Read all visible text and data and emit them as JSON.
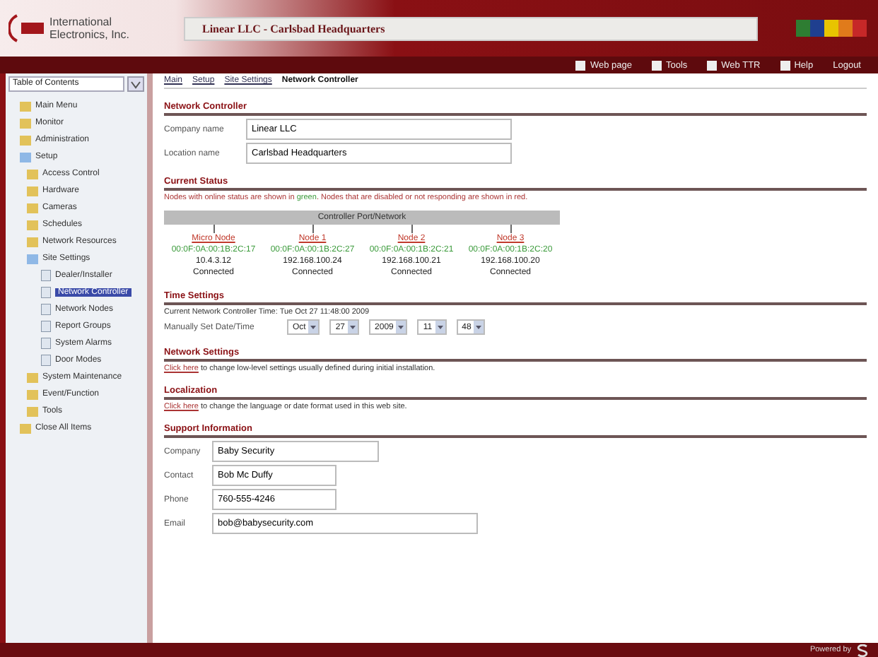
{
  "brand": {
    "name_line1": "International",
    "name_line2": "Electronics, Inc."
  },
  "window": {
    "title": "Linear LLC - Carlsbad Headquarters"
  },
  "nav": [
    {
      "label": "Web page"
    },
    {
      "label": "Tools"
    },
    {
      "label": "Web TTR"
    },
    {
      "label": "Help"
    },
    {
      "label": "Logout"
    }
  ],
  "sidebar": {
    "select": "Table of Contents",
    "items": [
      {
        "label": "Main Menu",
        "expanded": false,
        "selected": false
      },
      {
        "label": "Monitor",
        "expanded": false,
        "selected": false
      },
      {
        "label": "Administration",
        "expanded": false,
        "selected": false
      },
      {
        "label": "Setup",
        "expanded": true,
        "selected": false,
        "children": [
          {
            "label": "Access Control",
            "expanded": false,
            "selected": false
          },
          {
            "label": "Hardware",
            "expanded": false,
            "selected": false
          },
          {
            "label": "Cameras",
            "expanded": false,
            "selected": false
          },
          {
            "label": "Schedules",
            "expanded": false,
            "selected": false
          },
          {
            "label": "Network Resources",
            "expanded": false,
            "selected": false
          },
          {
            "label": "Site Settings",
            "expanded": true,
            "selected": false,
            "children": [
              {
                "label": "Dealer/Installer",
                "selected": false
              },
              {
                "label": "Network Controller",
                "selected": true
              },
              {
                "label": "Network Nodes",
                "selected": false
              },
              {
                "label": "Report Groups",
                "selected": false
              },
              {
                "label": "System Alarms",
                "selected": false
              },
              {
                "label": "Door Modes",
                "selected": false
              }
            ]
          },
          {
            "label": "System Maintenance",
            "expanded": false,
            "selected": false
          },
          {
            "label": "Event/Function",
            "expanded": false,
            "selected": false
          },
          {
            "label": "Tools",
            "expanded": false,
            "selected": false
          }
        ]
      },
      {
        "label": "Close All Items",
        "expanded": false,
        "selected": false
      }
    ]
  },
  "breadcrumb": [
    {
      "label": "Main",
      "current": false
    },
    {
      "label": "Setup",
      "current": false
    },
    {
      "label": "Site Settings",
      "current": false
    },
    {
      "label": "Network Controller",
      "current": true
    }
  ],
  "network_controller": {
    "title": "Network Controller",
    "fields": [
      {
        "label": "Company name",
        "value": "Linear LLC"
      },
      {
        "label": "Location name",
        "value": "Carlsbad Headquarters"
      }
    ]
  },
  "current_status": {
    "title": "Current Status",
    "note": "Nodes with online status are shown in **green**. Nodes that are disabled or not responding are shown in red.",
    "bus": "Controller Port/Network",
    "nodes": [
      {
        "name": "Micro Node",
        "mac": "00:0F:0A:00:1B:2C:17",
        "ip": "10.4.3.12",
        "status": "Connected",
        "color": "#3a9a3a"
      },
      {
        "name": "Node 1",
        "mac": "00:0F:0A:00:1B:2C:27",
        "ip": "192.168.100.24",
        "status": "Connected",
        "color": "#3a9a3a"
      },
      {
        "name": "Node 2",
        "mac": "00:0F:0A:00:1B:2C:21",
        "ip": "192.168.100.21",
        "status": "Connected",
        "color": "#3a9a3a"
      },
      {
        "name": "Node 3",
        "mac": "00:0F:0A:00:1B:2C:20",
        "ip": "192.168.100.20",
        "status": "Connected",
        "color": "#3a9a3a"
      }
    ]
  },
  "time_settings": {
    "title": "Time Settings",
    "current": "Current Network Controller Time: Tue Oct 27 11:48:00 2009",
    "manual_label": "Manually Set Date/Time",
    "selects": [
      "Oct",
      "27",
      "2009",
      "11",
      "48"
    ]
  },
  "network_settings": {
    "title": "Network Settings",
    "link": "Click here",
    "text": " to change low-level settings usually defined during initial installation."
  },
  "localization": {
    "title": "Localization",
    "link": "Click here",
    "text": " to change the language or date format used in this web site."
  },
  "support": {
    "title": "Support Information",
    "fields": [
      {
        "label": "Company",
        "value": "Baby Security"
      },
      {
        "label": "Contact",
        "value": "Bob Mc Duffy"
      },
      {
        "label": "Phone",
        "value": "760-555-4246"
      },
      {
        "label": "Email",
        "value": "bob@babysecurity.com"
      }
    ]
  },
  "footer": {
    "text": "Powered by"
  }
}
